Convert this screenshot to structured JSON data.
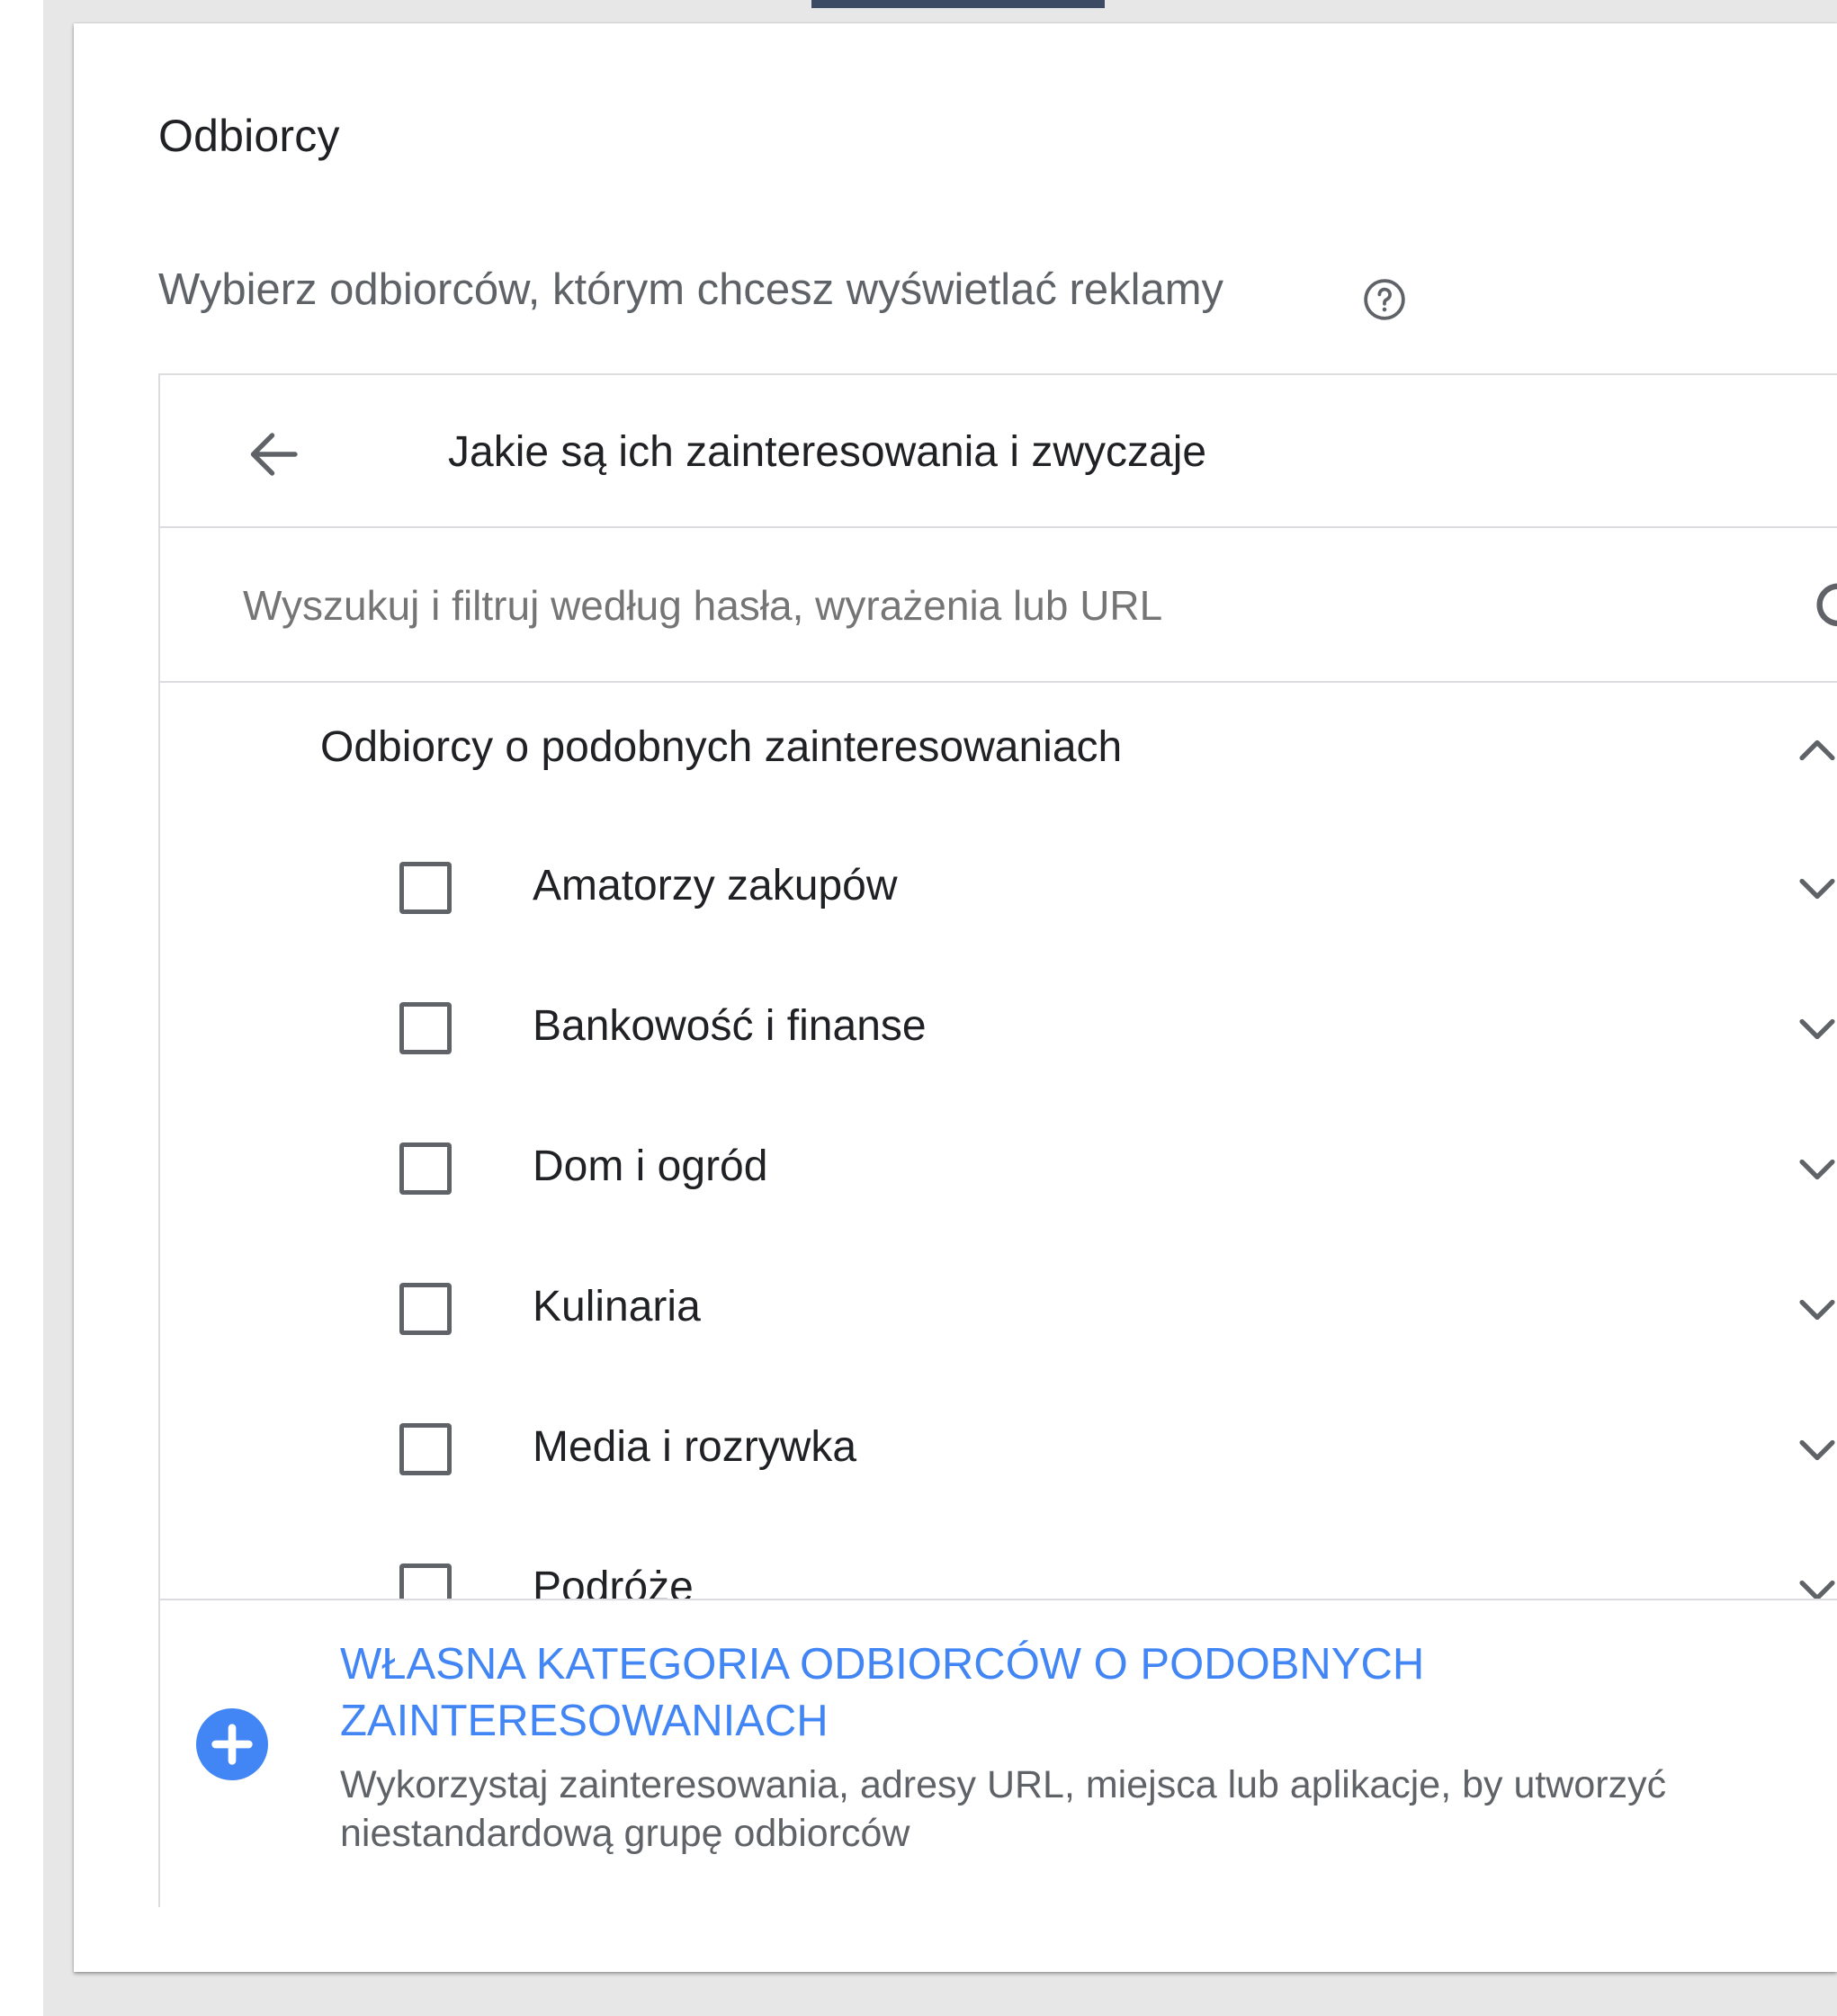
{
  "section": {
    "title": "Odbiorcy",
    "subtitle": "Wybierz odbiorców, którym chcesz wyświetlać reklamy"
  },
  "panel": {
    "header_title": "Jakie są ich zainteresowania i zwyczaje",
    "search_placeholder": "Wyszukuj i filtruj według hasła, wyrażenia lub URL",
    "search_value": ""
  },
  "group": {
    "title": "Odbiorcy o podobnych zainteresowaniach",
    "expanded": true,
    "items": [
      {
        "label": "Amatorzy zakupów",
        "checked": false
      },
      {
        "label": "Bankowość i finanse",
        "checked": false
      },
      {
        "label": "Dom i ogród",
        "checked": false
      },
      {
        "label": "Kulinaria",
        "checked": false
      },
      {
        "label": "Media i rozrywka",
        "checked": false
      },
      {
        "label": "Podróże",
        "checked": false
      }
    ]
  },
  "footer": {
    "title": "WŁASNA KATEGORIA ODBIORCÓW O PODOBNYCH ZAINTERESOWANIACH",
    "description": "Wykorzystaj zainteresowania, adresy URL, miejsca lub aplikacje, by utworzyć niestandardową grupę odbiorców"
  },
  "icons": {
    "help": "help-circle-icon",
    "back": "arrow-back-icon",
    "search": "search-icon",
    "collapse": "chevron-up-icon",
    "expand": "chevron-down-icon",
    "add": "add-circle-icon"
  },
  "colors": {
    "accent": "#4285f4",
    "text_primary": "#202124",
    "text_secondary": "#5f6368",
    "divider": "#dadce0",
    "page_background": "#e7e7e7",
    "top_tab": "#3c4a63"
  }
}
